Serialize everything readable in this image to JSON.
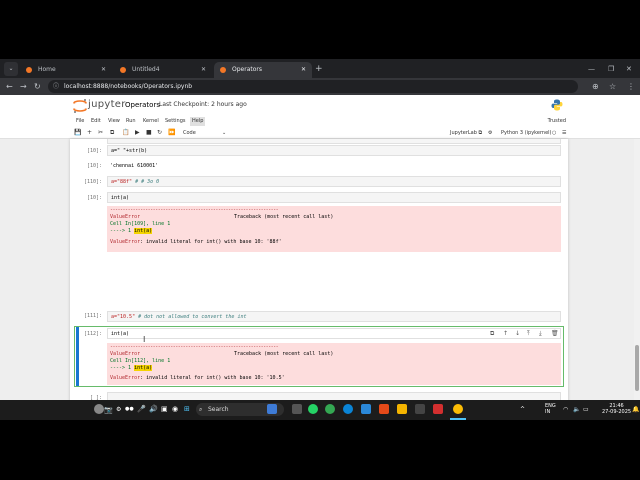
{
  "browser": {
    "tabs": [
      {
        "label": "Home",
        "active": false
      },
      {
        "label": "Untitled4",
        "active": false
      },
      {
        "label": "Operators",
        "active": true
      }
    ],
    "url": "localhost:8888/notebooks/Operators.ipynb"
  },
  "jupyter": {
    "logo_text": "jupyter",
    "notebook_title": "Operators",
    "checkpoint": "Last Checkpoint: 2 hours ago",
    "menu": [
      "File",
      "Edit",
      "View",
      "Run",
      "Kernel",
      "Settings",
      "Help"
    ],
    "active_menu": "Help",
    "trusted": "Trusted",
    "cell_type": "Code",
    "jupyterlab_label": "JupyterLab",
    "kernel": "Python 3 (ipykernel)"
  },
  "cells": {
    "c1": {
      "prompt": "[10]:",
      "code": "a=\" \"+str(b)"
    },
    "c1_out": {
      "prompt": "[10]:",
      "text": "'chennai 610001'"
    },
    "c2": {
      "prompt": "[110]:",
      "code_str": "a=\"88f\"",
      "code_comment": " # # 3o 0"
    },
    "c3": {
      "prompt": "[10]:",
      "code": "int(a)"
    },
    "c3_err": {
      "dash": "-------------------------------------------------------------------",
      "name": "ValueError",
      "traceback": "Traceback (most recent call last)",
      "cell_ref": "Cell In[109], line 1",
      "arrow": "----> 1 ",
      "arrow_code": "int(a)",
      "msg_name": "ValueError",
      "msg": ": invalid literal for int() with base 10: '88f'"
    },
    "c4": {
      "prompt": "[111]:",
      "code_str": "a=\"10.5\"",
      "code_comment": " # dot not allowed to convert the int"
    },
    "c5": {
      "prompt": "[112]:",
      "code": "int(a)"
    },
    "c5_err": {
      "dash": "-------------------------------------------------------------------",
      "name": "ValueError",
      "traceback": "Traceback (most recent call last)",
      "cell_ref": "Cell In[112], line 1",
      "arrow": "----> 1 ",
      "arrow_code": "int(a)",
      "msg_name": "ValueError",
      "msg": ": invalid literal for int() with base 10: '10.5'"
    },
    "c6": {
      "prompt": "[ ]:",
      "code": ""
    }
  },
  "taskbar": {
    "search": "Search",
    "lang1": "ENG",
    "lang2": "IN",
    "time": "21:46",
    "date": "27-09-2025"
  }
}
